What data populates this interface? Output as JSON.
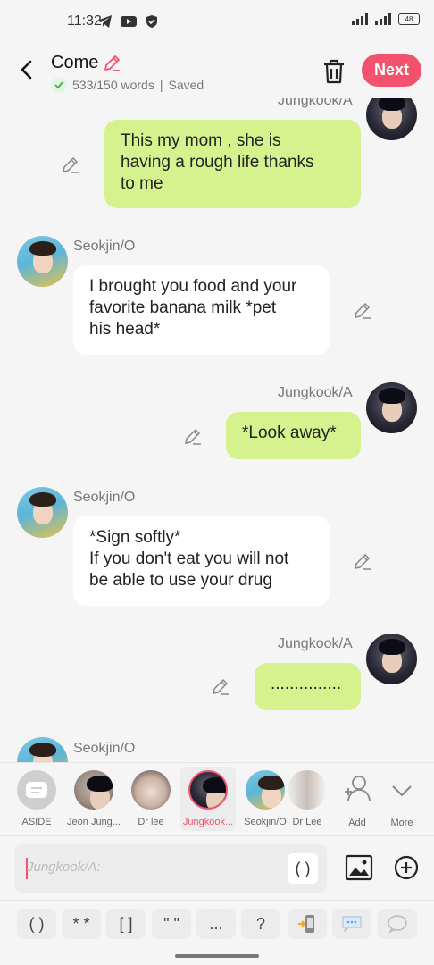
{
  "status": {
    "time": "11:32",
    "battery": "48"
  },
  "header": {
    "title": "Come",
    "words": "533/150 words",
    "saved": "Saved",
    "next_label": "Next"
  },
  "messages": [
    {
      "speaker": "Jungkook/A",
      "side": "right",
      "text": "This my mom , she is\nhaving a rough life thanks\nto me",
      "show_name": true
    },
    {
      "speaker": "Seokjin/O",
      "side": "left",
      "text": "I brought you food and your\nfavorite banana milk *pet\nhis head*"
    },
    {
      "speaker": "Jungkook/A",
      "side": "right",
      "text": "*Look away*"
    },
    {
      "speaker": "Seokjin/O",
      "side": "left",
      "text": "*Sign softly*\nIf you don't eat you will not\nbe able to use your drug"
    },
    {
      "speaker": "Jungkook/A",
      "side": "right",
      "text": "..............."
    },
    {
      "speaker": "Seokjin/O",
      "side": "left",
      "text": ""
    }
  ],
  "characters": [
    {
      "label": "ASIDE"
    },
    {
      "label": "Jeon Jung..."
    },
    {
      "label": "Dr lee"
    },
    {
      "label": "Jungkook..."
    },
    {
      "label": "Seokjin/O"
    },
    {
      "label": "Dr Lee"
    },
    {
      "label": "Add"
    },
    {
      "label": "More"
    }
  ],
  "input": {
    "placeholder": "Jungkook/A:",
    "paren": "( )"
  },
  "toolbar": [
    "( )",
    "* *",
    "[ ]",
    "\" \"",
    "...",
    "?"
  ],
  "colors": {
    "accent": "#f2526d",
    "green_bubble": "#d6f28e",
    "white_bubble": "#ffffff"
  }
}
